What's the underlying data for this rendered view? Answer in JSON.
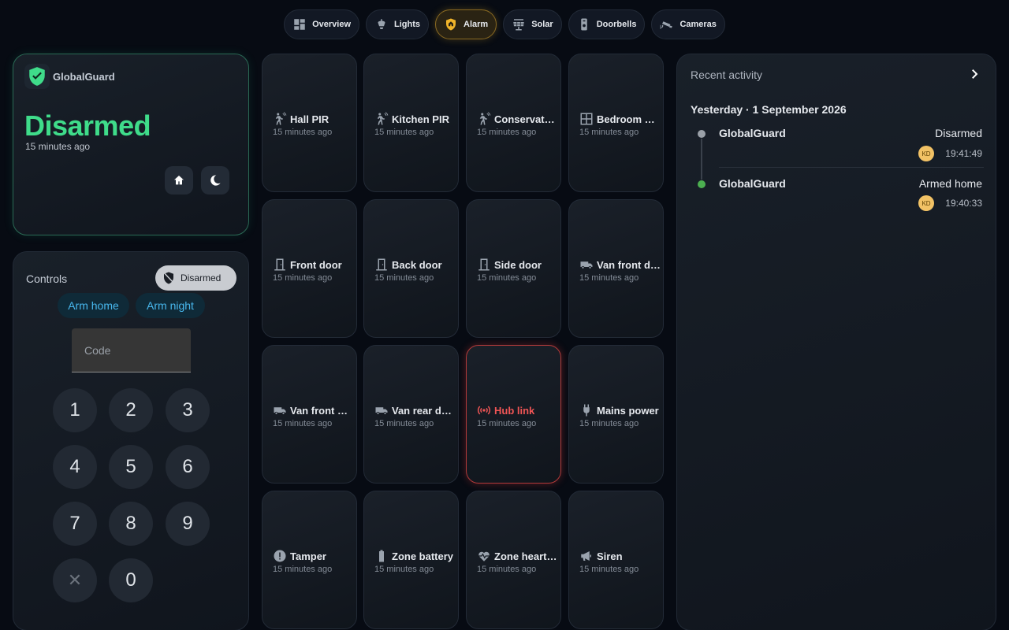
{
  "nav": {
    "tabs": [
      {
        "label": "Overview",
        "icon": "dashboard-icon"
      },
      {
        "label": "Lights",
        "icon": "ceiling-light-icon"
      },
      {
        "label": "Alarm",
        "icon": "shield-home-icon",
        "active": true
      },
      {
        "label": "Solar",
        "icon": "solar-panel-icon"
      },
      {
        "label": "Doorbells",
        "icon": "doorbell-icon"
      },
      {
        "label": "Cameras",
        "icon": "cctv-icon"
      }
    ]
  },
  "status": {
    "brand": "GlobalGuard",
    "state": "Disarmed",
    "time": "15 minutes ago",
    "state_color": "#3fdc8a"
  },
  "controls": {
    "title": "Controls",
    "chip_label": "Disarmed",
    "arm_home": "Arm home",
    "arm_night": "Arm night",
    "code_placeholder": "Code",
    "keys": [
      "1",
      "2",
      "3",
      "4",
      "5",
      "6",
      "7",
      "8",
      "9",
      "✕",
      "0"
    ]
  },
  "sensors": [
    {
      "name": "Hall PIR",
      "time": "15 minutes ago",
      "icon": "motion-sensor-icon"
    },
    {
      "name": "Kitchen PIR",
      "time": "15 minutes ago",
      "icon": "motion-sensor-icon"
    },
    {
      "name": "Conservatory PIR",
      "time": "15 minutes ago",
      "icon": "motion-sensor-icon"
    },
    {
      "name": "Bedroom window",
      "time": "15 minutes ago",
      "icon": "window-icon"
    },
    {
      "name": "Front door",
      "time": "15 minutes ago",
      "icon": "door-icon"
    },
    {
      "name": "Back door",
      "time": "15 minutes ago",
      "icon": "door-icon"
    },
    {
      "name": "Side door",
      "time": "15 minutes ago",
      "icon": "door-icon"
    },
    {
      "name": "Van front door",
      "time": "15 minutes ago",
      "icon": "van-icon"
    },
    {
      "name": "Van front window",
      "time": "15 minutes ago",
      "icon": "van-icon"
    },
    {
      "name": "Van rear door",
      "time": "15 minutes ago",
      "icon": "van-icon"
    },
    {
      "name": "Hub link",
      "time": "15 minutes ago",
      "icon": "radio-tower-icon",
      "alert": true
    },
    {
      "name": "Mains power",
      "time": "15 minutes ago",
      "icon": "power-plug-icon"
    },
    {
      "name": "Tamper",
      "time": "15 minutes ago",
      "icon": "alert-circle-icon"
    },
    {
      "name": "Zone battery",
      "time": "15 minutes ago",
      "icon": "battery-icon"
    },
    {
      "name": "Zone heartbeat",
      "time": "15 minutes ago",
      "icon": "heart-pulse-icon"
    },
    {
      "name": "Siren",
      "time": "15 minutes ago",
      "icon": "bullhorn-icon"
    }
  ],
  "activity": {
    "title": "Recent activity",
    "date_header": "Yesterday · 1 September 2026",
    "events": [
      {
        "source": "GlobalGuard",
        "state": "Disarmed",
        "user": "KD",
        "time": "19:41:49",
        "dot_color": "#9aa0a8"
      },
      {
        "source": "GlobalGuard",
        "state": "Armed home",
        "user": "KD",
        "time": "19:40:33",
        "dot_color": "#4caf50"
      }
    ]
  },
  "colors": {
    "accent_alarm": "#f0b42a",
    "alert_red": "#f05555",
    "arm_text": "#48b8ee"
  }
}
